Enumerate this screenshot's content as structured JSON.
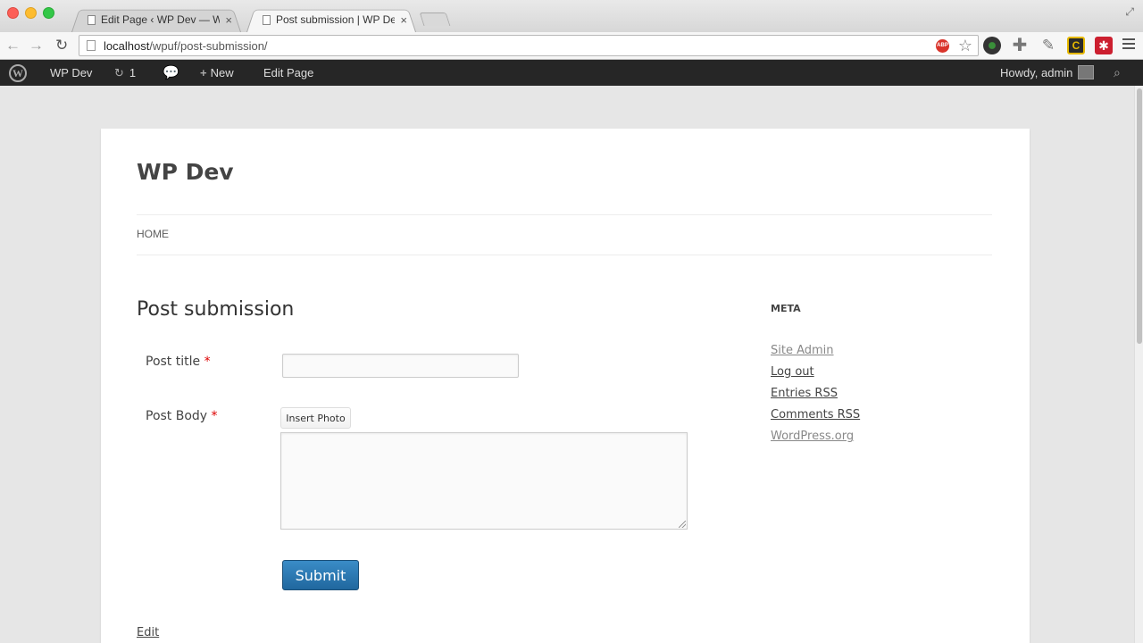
{
  "browser": {
    "tabs": [
      {
        "title": "Edit Page ‹ WP Dev — Word",
        "close": "×"
      },
      {
        "title": "Post submission | WP Dev",
        "close": "×"
      }
    ],
    "url_host": "localhost",
    "url_path": "/wpuf/post-submission/",
    "icons": {
      "back": "arrow-left",
      "forward": "arrow-right",
      "reload": "reload",
      "adblock_label": "ABP",
      "bookmark": "star",
      "extension_lastpass_label": "C",
      "extension_red_label": "✱"
    }
  },
  "adminbar": {
    "site_name": "WP Dev",
    "updates_count": "1",
    "new_label": "New",
    "edit_label": "Edit Page",
    "howdy": "Howdy, admin",
    "wp_logo": "W"
  },
  "site": {
    "title": "WP Dev",
    "menu": [
      "HOME"
    ]
  },
  "page": {
    "title": "Post submission",
    "form": {
      "post_title_label": "Post title",
      "post_body_label": "Post Body",
      "required_mark": "*",
      "insert_photo_label": "Insert Photo",
      "submit_label": "Submit"
    },
    "edit_link": "Edit"
  },
  "sidebar": {
    "widget_title": "META",
    "links": [
      "Site Admin",
      "Log out",
      "Entries RSS",
      "Comments RSS",
      "WordPress.org"
    ]
  },
  "colors": {
    "adminbar": "#262626",
    "submit_button": "#2a78b3",
    "required": "#dd0000"
  }
}
